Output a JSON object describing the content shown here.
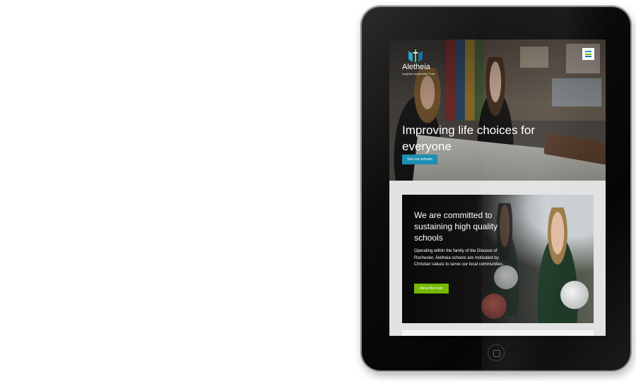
{
  "site": {
    "logo": {
      "name": "Aletheia",
      "tagline": "Anglican Academies Trust",
      "colors": [
        "#2aa4c8",
        "#8cc63f",
        "#1c6fa0"
      ]
    },
    "menu": {
      "icon": "hamburger-menu-icon",
      "bar_colors": [
        "#1c8fb2",
        "#76b900",
        "#1c6fa0"
      ]
    }
  },
  "hero": {
    "title": "Improving life choices for everyone",
    "cta_label": "See our schools",
    "cta_color": "#1c8fb2"
  },
  "committed": {
    "title": "We are committed to sustaining high quality schools",
    "body": "Operating within the family of the Diocese of Rochester, Aletheia schools are motivated by Christian values to serve our local communities.",
    "cta_label": "About the trust",
    "cta_color": "#76b900"
  }
}
